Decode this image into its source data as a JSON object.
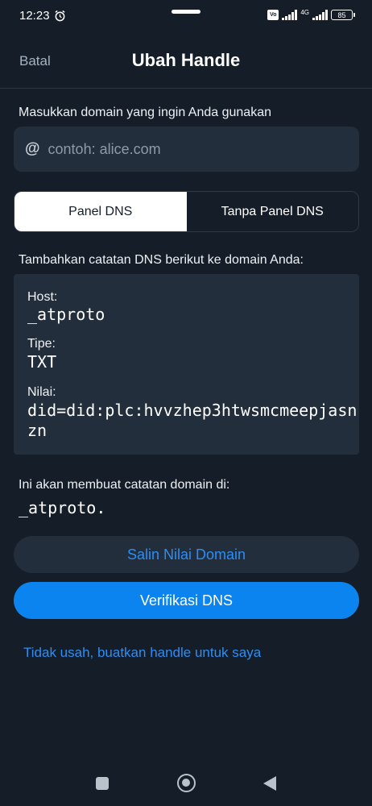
{
  "status_bar": {
    "time": "12:23",
    "network": "4G",
    "battery": "85"
  },
  "header": {
    "cancel_label": "Batal",
    "title": "Ubah Handle"
  },
  "domain": {
    "prompt": "Masukkan domain yang ingin Anda gunakan",
    "at_symbol": "@",
    "placeholder": "contoh: alice.com",
    "value": ""
  },
  "tabs": [
    {
      "label": "Panel DNS",
      "active": true
    },
    {
      "label": "Tanpa Panel DNS",
      "active": false
    }
  ],
  "dns": {
    "instruction": "Tambahkan catatan DNS berikut ke domain Anda:",
    "host_label": "Host:",
    "host_value": "_atproto",
    "type_label": "Tipe:",
    "type_value": "TXT",
    "value_label": "Nilai:",
    "value_value": "did=did:plc:hvvzhep3htwsmcmeepjasnzn"
  },
  "record": {
    "note": "Ini akan membuat catatan domain di:",
    "domain_value": "_atproto."
  },
  "actions": {
    "copy_label": "Salin Nilai Domain",
    "verify_label": "Verifikasi DNS",
    "skip_link": "Tidak usah, buatkan handle untuk saya"
  },
  "colors": {
    "background": "#151d28",
    "surface": "#222e3c",
    "accent": "#0c84f0",
    "link": "#2c8ef5"
  },
  "icons": [
    "alarm-icon",
    "signal-icon",
    "battery-icon",
    "at-icon",
    "nav-square-icon",
    "nav-home-icon",
    "nav-back-icon"
  ]
}
